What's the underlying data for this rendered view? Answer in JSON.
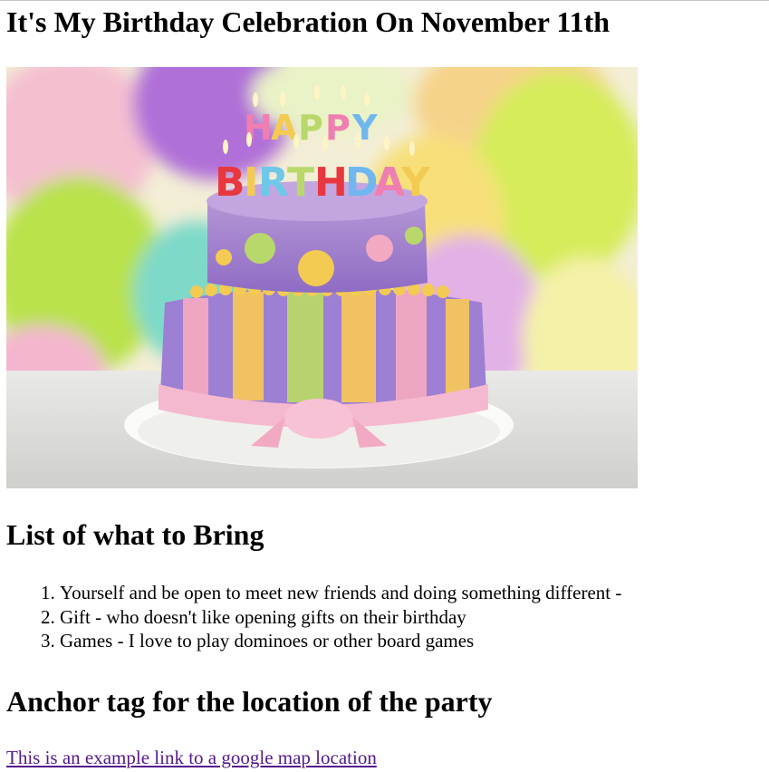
{
  "page": {
    "title": "It's My Birthday Celebration On November 11th"
  },
  "image": {
    "cake_topper_line1": "HAPPY",
    "cake_topper_line2": "BIRTHDAY"
  },
  "bring_section": {
    "heading": "List of what to Bring",
    "items": [
      "Yourself and be open to meet new friends and doing something different -",
      "Gift - who doesn't like opening gifts on their birthday",
      "Games - I love to play dominoes or other board games"
    ]
  },
  "location_section": {
    "heading": "Anchor tag for the location of the party",
    "link_text": "This is an example link to a google map location"
  },
  "colors": {
    "visited_link": "#551a8b",
    "text": "#000000",
    "background": "#ffffff"
  }
}
